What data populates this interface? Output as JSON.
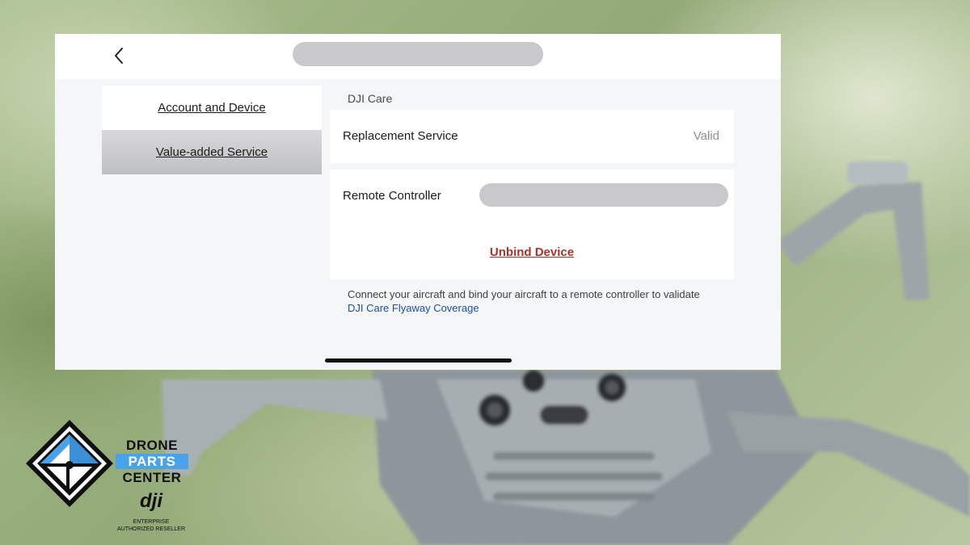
{
  "header": {
    "back_icon": "chevron-left-icon"
  },
  "sidebar": {
    "items": [
      {
        "label": "Account and Device",
        "active": false
      },
      {
        "label": "Value-added Service",
        "active": true
      }
    ]
  },
  "content": {
    "section_label": "DJI Care",
    "replacement_service": {
      "label": "Replacement Service",
      "status": "Valid"
    },
    "remote_controller": {
      "label": "Remote Controller"
    },
    "unbind_label": "Unbind Device",
    "note_text": "Connect your aircraft and bind your aircraft to a remote controller to validate",
    "note_link": "DJI Care Flyaway Coverage"
  },
  "logo": {
    "line1": "DRONE",
    "line2": "PARTS",
    "line3": "CENTER",
    "brand": "dji",
    "tag1": "ENTERPRISE",
    "tag2": "AUTHORIZED RESELLER"
  },
  "colors": {
    "unbind": "#a8322d",
    "link": "#1a4ea8",
    "logo_blue": "#4aa3e8"
  }
}
